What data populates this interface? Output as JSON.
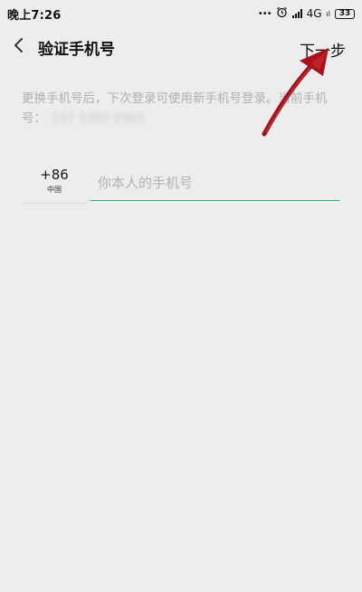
{
  "status_bar": {
    "time": "晚上7:26",
    "dots": "•••",
    "network": "4G",
    "network_sub": "ıl",
    "battery": "33",
    "icons": [
      "alarm-icon",
      "signal-icon",
      "battery-icon"
    ]
  },
  "nav": {
    "title": "验证手机号",
    "next_label": "下一步",
    "back_icon": "chevron-left-icon"
  },
  "hint": {
    "text": "更换手机号后，下次登录可使用新手机号登录。当前手机号：",
    "masked_number": "157 5355 0303"
  },
  "phone": {
    "country_code": "+86",
    "country_name": "中国",
    "placeholder": "你本人的手机号",
    "value": ""
  },
  "colors": {
    "background": "#ededed",
    "input_underline": "#21b36f",
    "annotation_arrow": "#b0141c"
  }
}
